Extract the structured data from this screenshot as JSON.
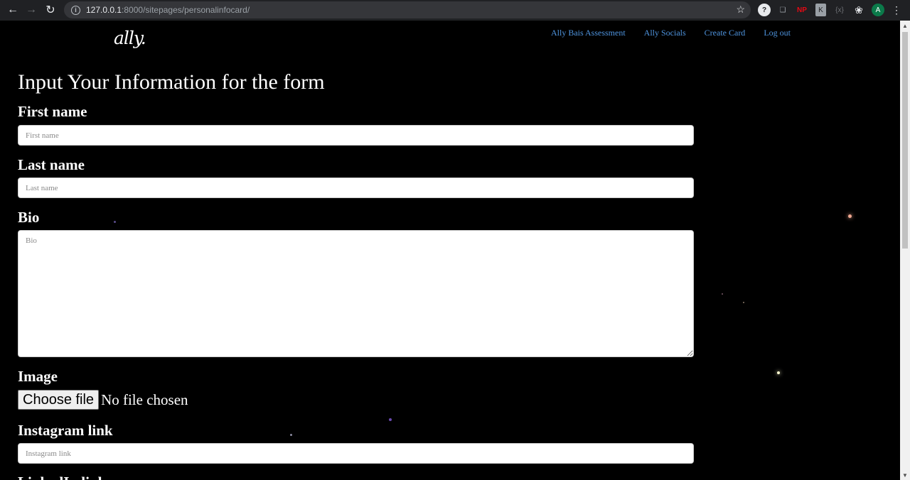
{
  "browser": {
    "url_host": "127.0.0.1",
    "url_path": ":8000/sitepages/personalinfocard/",
    "profile_initial": "A",
    "ext_np": "NP"
  },
  "site": {
    "logo": "ally.",
    "nav": [
      "Ally Bais Assessment",
      "Ally Socials",
      "Create Card",
      "Log out"
    ]
  },
  "form": {
    "title": "Input Your Information for the form",
    "first_name": {
      "label": "First name",
      "placeholder": "First name",
      "value": ""
    },
    "last_name": {
      "label": "Last name",
      "placeholder": "Last name",
      "value": ""
    },
    "bio": {
      "label": "Bio",
      "placeholder": "Bio",
      "value": ""
    },
    "image": {
      "label": "Image",
      "button": "Choose file",
      "status": "No file chosen"
    },
    "instagram": {
      "label": "Instagram link",
      "placeholder": "Instagram link",
      "value": ""
    },
    "next_label": "LinkedIn link"
  }
}
